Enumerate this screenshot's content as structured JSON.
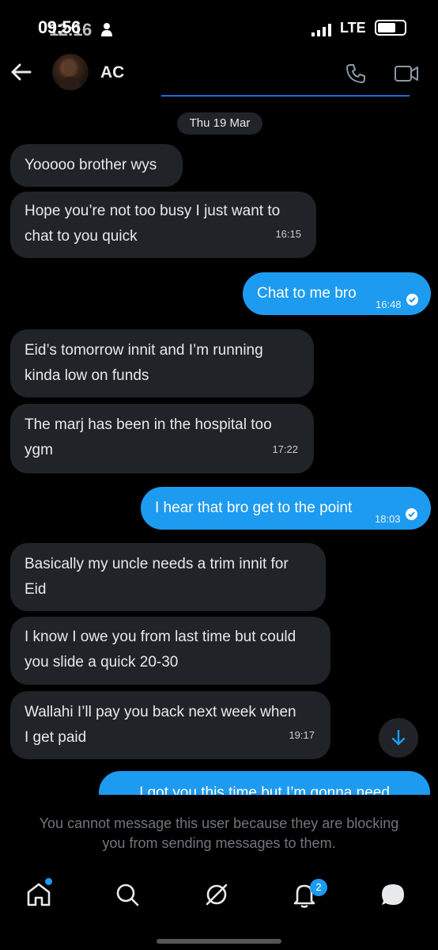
{
  "status_bar": {
    "time": "09:56",
    "time_overlap": "12:16",
    "network": "LTE"
  },
  "header": {
    "contact_name": "AC"
  },
  "conversation": {
    "date": "Thu 19 Mar",
    "messages": [
      {
        "text_1": "Yooooo brother wys"
      },
      {
        "text_1": "Hope you’re not too busy I just want to",
        "text_2": "chat to you quick",
        "time": "16:15"
      },
      {
        "text_1": "Chat to me bro",
        "time": "16:48"
      },
      {
        "text_1": "Eid’s tomorrow innit and I’m running",
        "text_2": "kinda low on funds"
      },
      {
        "text_1": "The marj has been in the hospital too",
        "text_2": "ygm",
        "time": "17:22"
      },
      {
        "text_1": "I hear that bro get to the point",
        "time": "18:03"
      },
      {
        "text_1": "Basically my uncle needs a trim innit for",
        "text_2": "Eid"
      },
      {
        "text_1": "I know I owe you from last time but could",
        "text_2": "you slide a quick 20-30"
      },
      {
        "text_1": "Wallahi I’ll pay you back next week when",
        "text_2": "I get paid",
        "time": "19:17"
      },
      {
        "text_1": "I got you this time but I’m gonna need"
      }
    ]
  },
  "composer": {
    "blocked_notice": "You cannot message this user because they are blocking you from sending messages to them."
  },
  "bottom_nav": {
    "notifications_badge": "2"
  },
  "colors": {
    "accent": "#1d9bf0",
    "incoming_bubble": "#202327",
    "background": "#000000"
  }
}
